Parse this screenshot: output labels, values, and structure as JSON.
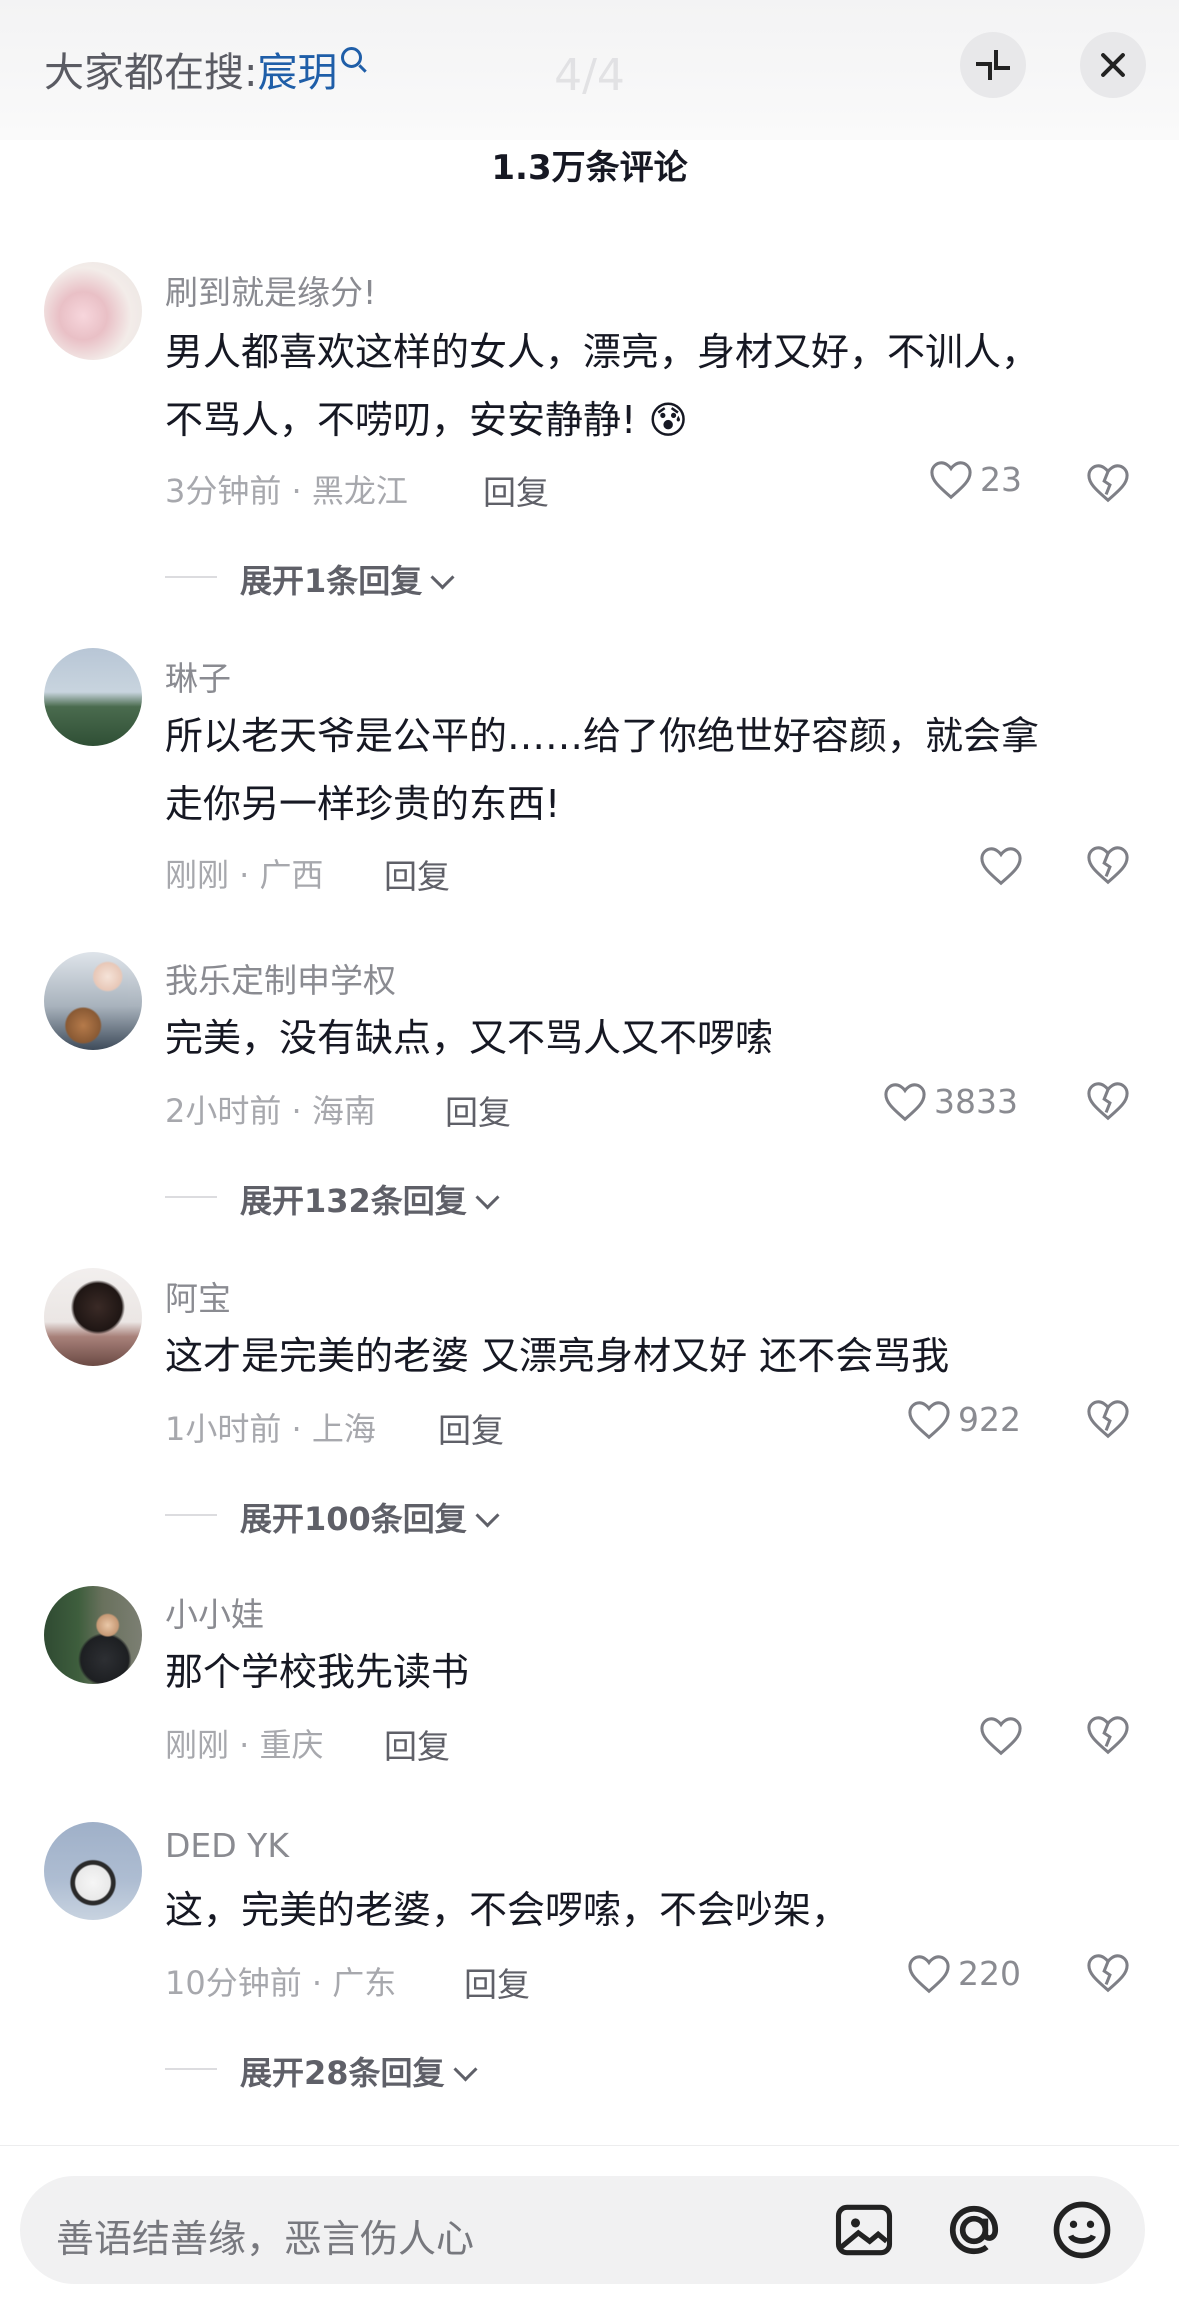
{
  "search": {
    "prefix": "大家都在搜:",
    "keyword": "宸玥"
  },
  "page_indicator": "4/4",
  "comment_count": "1.3万条评论",
  "comments": [
    {
      "user": "刷到就是缘分!",
      "lines": [
        "男人都喜欢这样的女人，漂亮，身材又好，不训人，",
        "不骂人，不唠叨，安安静静! 😰"
      ],
      "time_loc": "3分钟前 · 黑龙江",
      "reply": "回复",
      "likes": "23",
      "expand": "展开1条回复"
    },
    {
      "user": "琳子",
      "lines": [
        "所以老天爷是公平的……给了你绝世好容颜，就会拿",
        "走你另一样珍贵的东西!"
      ],
      "time_loc": "刚刚 · 广西",
      "reply": "回复",
      "likes": "",
      "expand": ""
    },
    {
      "user": "我乐定制申学权",
      "lines": [
        "完美，没有缺点，又不骂人又不啰嗦"
      ],
      "time_loc": "2小时前 · 海南",
      "reply": "回复",
      "likes": "3833",
      "expand": "展开132条回复"
    },
    {
      "user": "阿宝",
      "lines": [
        "这才是完美的老婆 又漂亮身材又好 还不会骂我"
      ],
      "time_loc": "1小时前 · 上海",
      "reply": "回复",
      "likes": "922",
      "expand": "展开100条回复"
    },
    {
      "user": "小小娃",
      "lines": [
        "那个学校我先读书"
      ],
      "time_loc": "刚刚 · 重庆",
      "reply": "回复",
      "likes": "",
      "expand": ""
    },
    {
      "user": "DED  YK",
      "lines": [
        "这，完美的老婆，不会啰嗦，不会吵架，"
      ],
      "time_loc": "10分钟前 · 广东",
      "reply": "回复",
      "likes": "220",
      "expand": "展开28条回复"
    }
  ],
  "input": {
    "placeholder": "善语结善缘，恶言伤人心"
  },
  "icons": [
    "search-icon",
    "collapse-icon",
    "close-icon",
    "like-heart-icon",
    "dislike-heart-icon",
    "chevron-down-icon",
    "image-icon",
    "at-icon",
    "emoji-icon"
  ]
}
